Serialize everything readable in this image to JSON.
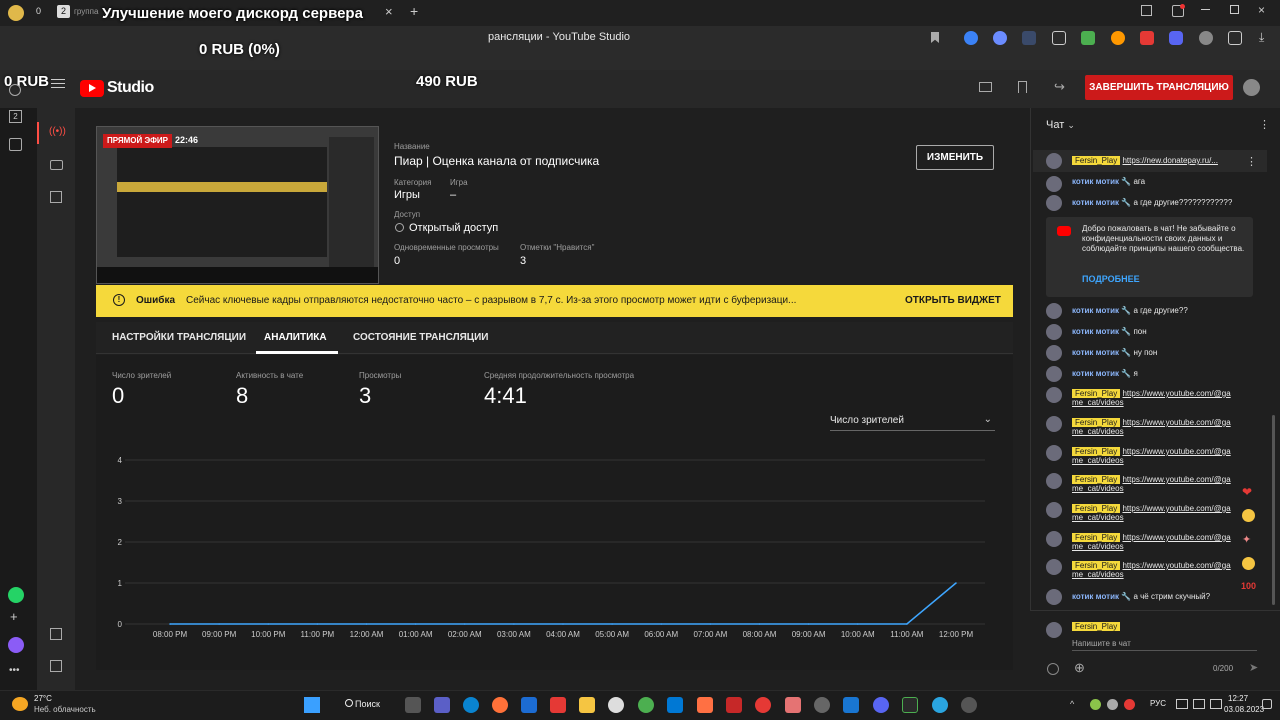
{
  "browser": {
    "tab_count_badge": "2",
    "tab_badge_0": "0",
    "tab_label": "группа",
    "window_title": "рансляции - YouTube Studio"
  },
  "overlay": {
    "title": "Улучшение моего дискорд сервера",
    "progress": "0 RUB (0%)",
    "left_amount": "0 RUB",
    "goal_amount": "490 RUB"
  },
  "studio": {
    "logo_text": "Studio",
    "end_stream": "ЗАВЕРШИТЬ ТРАНСЛЯЦИЮ"
  },
  "stream": {
    "live_badge": "ПРЯМОЙ ЭФИР",
    "live_time": "22:46",
    "title_label": "Название",
    "title": "Пиар | Оценка канала от подписчика",
    "category_label": "Категория",
    "category": "Игры",
    "game_label": "Игра",
    "game": "–",
    "access_label": "Доступ",
    "access": "Открытый доступ",
    "concurrent_label": "Одновременные просмотры",
    "concurrent": "0",
    "likes_label": "Отметки \"Нравится\"",
    "likes": "3",
    "edit_button": "ИЗМЕНИТЬ"
  },
  "alert": {
    "kind": "Ошибка",
    "message": "Сейчас ключевые кадры отправляются недостаточно часто – с разрывом в 7,7 с. Из-за этого просмотр может идти с буферизаци...",
    "action": "ОТКРЫТЬ ВИДЖЕТ"
  },
  "tabs": [
    "НАСТРОЙКИ ТРАНСЛЯЦИИ",
    "АНАЛИТИКА",
    "СОСТОЯНИЕ ТРАНСЛЯЦИИ"
  ],
  "stats": [
    {
      "label": "Число зрителей",
      "value": "0"
    },
    {
      "label": "Активность в чате",
      "value": "8"
    },
    {
      "label": "Просмотры",
      "value": "3"
    },
    {
      "label": "Средняя продолжительность просмотра",
      "value": "4:41"
    }
  ],
  "metric_select": "Число зрителей",
  "chart_data": {
    "type": "line",
    "x": [
      "08:00 PM",
      "09:00 PM",
      "10:00 PM",
      "11:00 PM",
      "12:00 AM",
      "01:00 AM",
      "02:00 AM",
      "03:00 AM",
      "04:00 AM",
      "05:00 AM",
      "06:00 AM",
      "07:00 AM",
      "08:00 AM",
      "09:00 AM",
      "10:00 AM",
      "11:00 AM",
      "12:00 PM"
    ],
    "y_ticks": [
      0,
      1,
      2,
      3,
      4
    ],
    "ylim": [
      0,
      4
    ],
    "series": [
      {
        "values": [
          0,
          0,
          0,
          0,
          0,
          0,
          0,
          0,
          0,
          0,
          0,
          0,
          0,
          0,
          0,
          0,
          1
        ]
      }
    ],
    "line_color": "#3ea6ff",
    "grid": true
  },
  "chat": {
    "header": "Чат",
    "pinned_author": "Fersin_Play",
    "pinned_text": "https://new.donatepay.ru/...",
    "messages": [
      {
        "author": "котик мотик",
        "text": "ага"
      },
      {
        "author": "котик мотик",
        "text": "а где другие????????????"
      }
    ],
    "welcome_text": "Добро пожаловать в чат! Не забывайте о конфиденциальности своих данных и соблюдайте принципы нашего сообщества.",
    "welcome_more": "ПОДРОБНЕЕ",
    "messages2": [
      {
        "author": "котик мотик",
        "text": "а где другие??"
      },
      {
        "author": "котик мотик",
        "text": "пон"
      },
      {
        "author": "котик мотик",
        "text": "ну пон"
      },
      {
        "author": "котик мотик",
        "text": "я"
      }
    ],
    "link_author": "Fersin_Play",
    "link_text": "https://www.youtube.com/@ga",
    "link_text2": "me_cat/videos",
    "last_author": "котик мотик",
    "last_text": "а чё стрим скучный?",
    "input_author": "Fersin_Play",
    "input_placeholder": "Напишите в чат",
    "char_count": "0/200"
  },
  "taskbar": {
    "weather_temp": "27°C",
    "weather_desc": "Неб. облачность",
    "search": "Поиск",
    "lang": "РУС",
    "time": "12:27",
    "date": "03.08.2023"
  }
}
